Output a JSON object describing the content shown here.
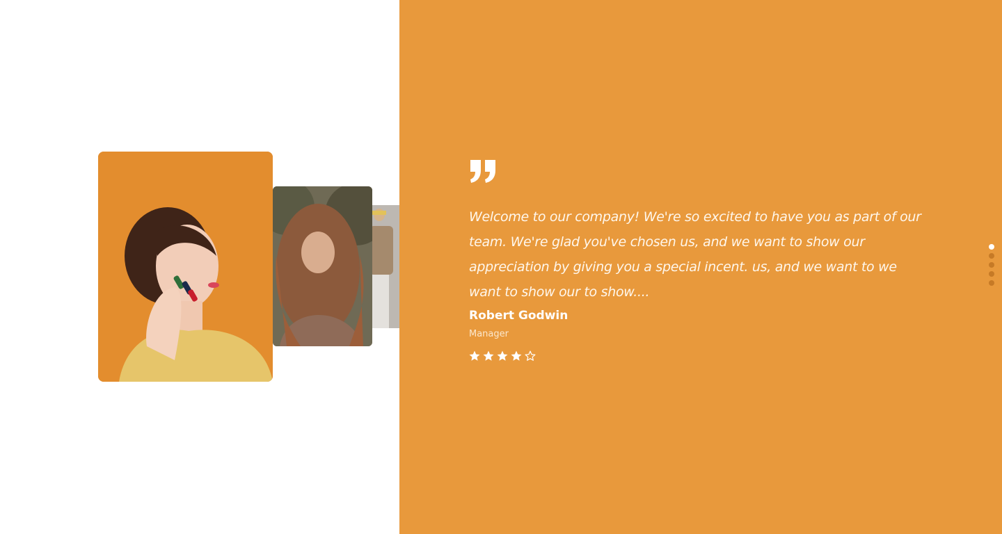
{
  "testimonial": {
    "quote": "Welcome to our company! We're so excited to have you as part of our team. We're glad you've chosen us, and we want to show our appreciation by giving you a special incent. us, and we want to we want to show our to show....",
    "author_name": "Robert Godwin",
    "author_role": "Manager",
    "rating": 4,
    "rating_max": 5
  },
  "icons": {
    "quote": "quote-icon",
    "star_filled": "star-filled-icon",
    "star_empty": "star-outline-icon"
  },
  "pagination": {
    "total": 5,
    "active_index": 0
  },
  "colors": {
    "accent": "#e8993c",
    "text_on_accent": "#ffffff",
    "dot_inactive": "#c67a26"
  }
}
